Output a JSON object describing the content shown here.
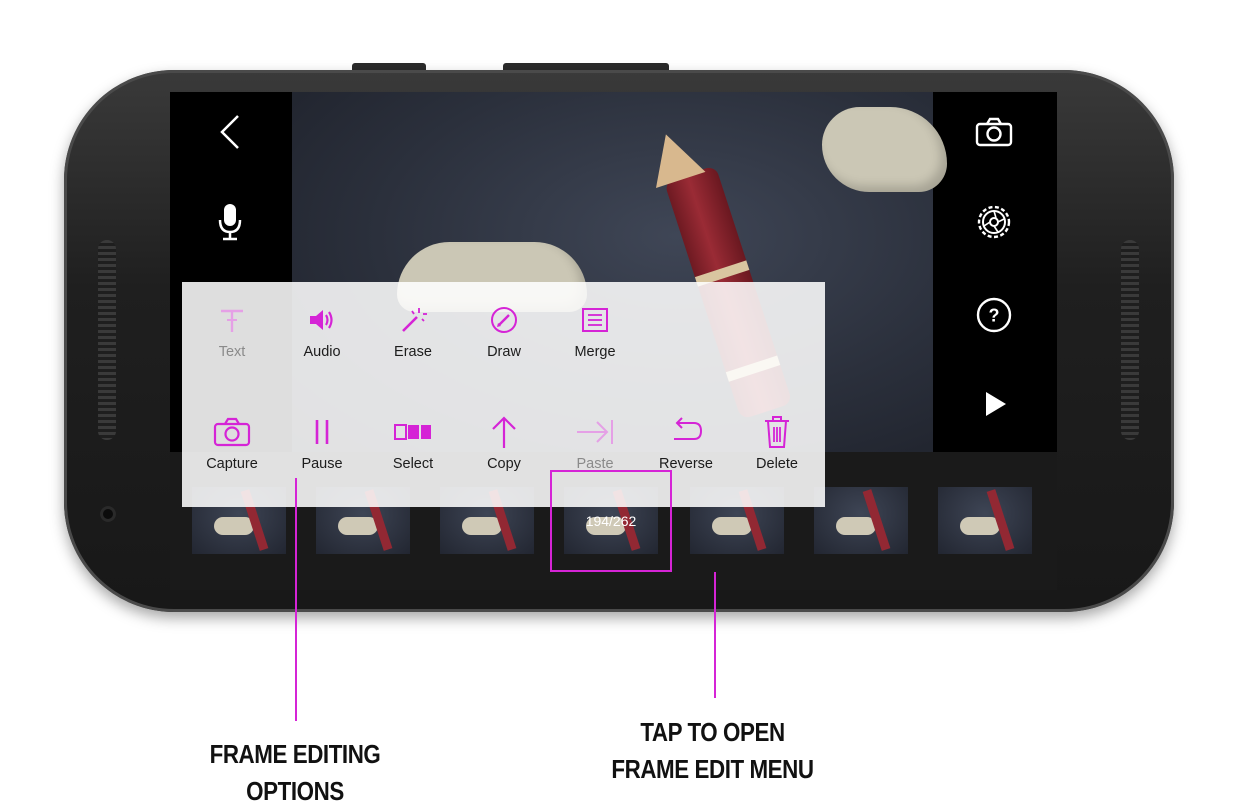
{
  "accent_color": "#d524d6",
  "left_controls": [
    {
      "name": "back-button",
      "icon": "chevron-left-icon"
    },
    {
      "name": "microphone-button",
      "icon": "microphone-icon"
    }
  ],
  "right_controls": [
    {
      "name": "camera-button",
      "icon": "camera-icon"
    },
    {
      "name": "settings-button",
      "icon": "aperture-gear-icon"
    },
    {
      "name": "help-button",
      "icon": "question-circle-icon"
    },
    {
      "name": "play-button",
      "icon": "play-icon"
    }
  ],
  "timeline": {
    "frame_counter": "194/262"
  },
  "menu": {
    "row1": [
      {
        "label": "Text",
        "icon": "text-icon",
        "enabled": false
      },
      {
        "label": "Audio",
        "icon": "speaker-icon",
        "enabled": true
      },
      {
        "label": "Erase",
        "icon": "magic-wand-icon",
        "enabled": true
      },
      {
        "label": "Draw",
        "icon": "pencil-circle-icon",
        "enabled": true
      },
      {
        "label": "Merge",
        "icon": "merge-document-icon",
        "enabled": true
      }
    ],
    "row2": [
      {
        "label": "Capture",
        "icon": "camera-icon",
        "enabled": true
      },
      {
        "label": "Pause",
        "icon": "pause-icon",
        "enabled": true
      },
      {
        "label": "Select",
        "icon": "select-frames-icon",
        "enabled": true
      },
      {
        "label": "Copy",
        "icon": "arrow-up-icon",
        "enabled": true
      },
      {
        "label": "Paste",
        "icon": "paste-arrow-icon",
        "enabled": false
      },
      {
        "label": "Reverse",
        "icon": "reverse-arrow-icon",
        "enabled": true
      },
      {
        "label": "Delete",
        "icon": "trash-icon",
        "enabled": true
      }
    ]
  },
  "callouts": {
    "frame_editing_line1": "FRAME EDITING",
    "frame_editing_line2": "OPTIONS",
    "tap_open_line1": "TAP TO OPEN",
    "tap_open_line2": "FRAME EDIT MENU"
  }
}
